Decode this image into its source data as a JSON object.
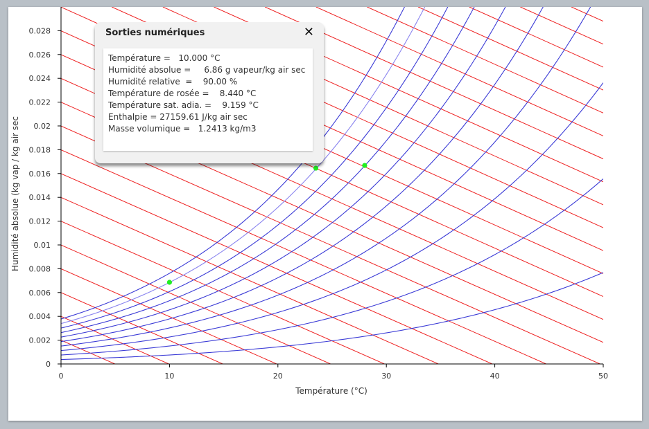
{
  "popup": {
    "title": "Sorties numériques",
    "close": "✕",
    "lines": [
      "Température =   10.000 °C",
      "Humidité absolue =     6.86 g vapeur/kg air sec",
      "Humidité relative  =    90.00 %",
      "Température de rosée =    8.440 °C",
      "Température sat. adia. =    9.159 °C",
      "Enthalpie = 27159.61 J/kg air sec",
      "Masse volumique =   1.2413 kg/m3"
    ]
  },
  "chart_data": {
    "type": "scatter",
    "title": "",
    "xlabel": "Température (°C)",
    "ylabel": "Humidité absolue (kg vap / kg air sec",
    "xlim": [
      0,
      50
    ],
    "ylim": [
      0,
      0.03
    ],
    "x_ticks": [
      "0",
      "10",
      "20",
      "30",
      "40",
      "50"
    ],
    "y_ticks": [
      "0",
      "0.002",
      "0.004",
      "0.006",
      "0.008",
      "0.01",
      "0.012",
      "0.014",
      "0.016",
      "0.018",
      "0.02",
      "0.022",
      "0.024",
      "0.026",
      "0.028"
    ],
    "relative_humidity_curves": [
      0.1,
      0.2,
      0.3,
      0.4,
      0.5,
      0.6,
      0.7,
      0.8,
      0.9,
      1.0
    ],
    "enthalpy_lines_kJ_per_kg": [
      5,
      10,
      15,
      20,
      25,
      30,
      35,
      40,
      45,
      50,
      55,
      60,
      65,
      70,
      75,
      80,
      85,
      90,
      95,
      100,
      105,
      110,
      115,
      120,
      125,
      130,
      135,
      140
    ],
    "points": [
      {
        "x": 10.0,
        "y": 0.00686
      },
      {
        "x": 23.5,
        "y": 0.01645
      },
      {
        "x": 28.0,
        "y": 0.01668
      }
    ],
    "colors": {
      "rh_curve": "#3b3bd6",
      "rh_highlight": "#8a84ef",
      "enthalpy": "#ee2222",
      "point": "#22ee22",
      "axis": "#000000",
      "tick_text": "#333333"
    },
    "grid": false
  }
}
